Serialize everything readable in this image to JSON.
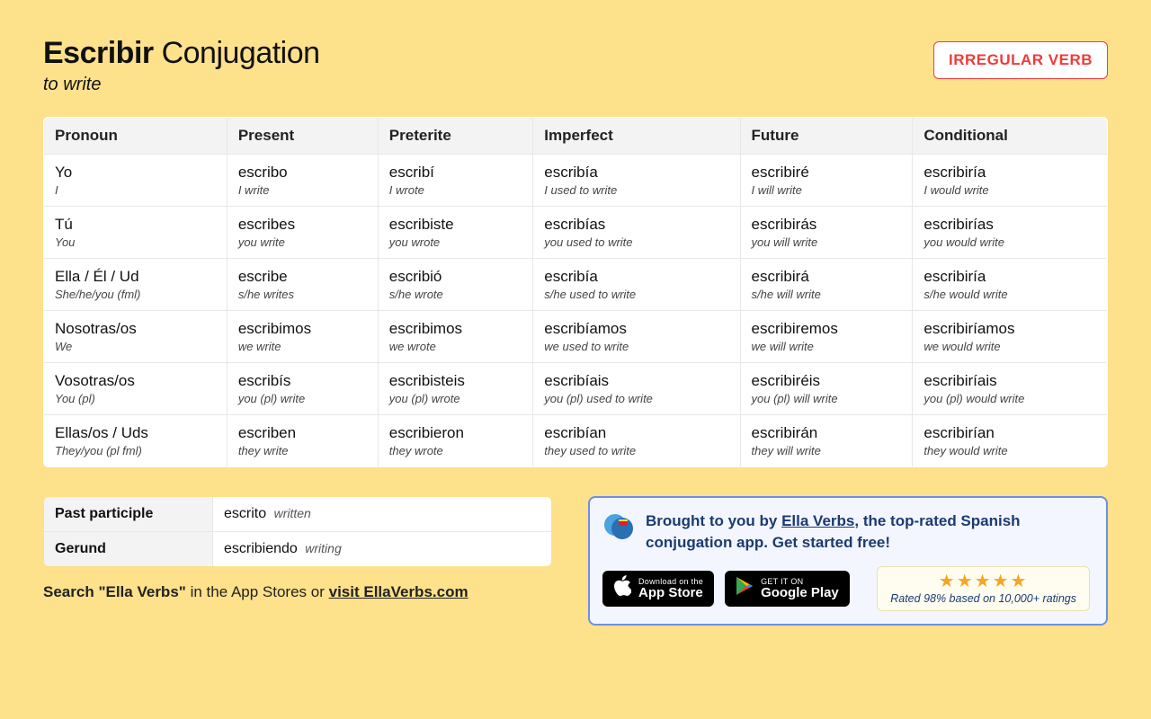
{
  "header": {
    "verb": "Escribir",
    "word_conjugation": "Conjugation",
    "translation": "to write",
    "badge": "IRREGULAR VERB"
  },
  "table": {
    "columns": [
      "Pronoun",
      "Present",
      "Preterite",
      "Imperfect",
      "Future",
      "Conditional"
    ],
    "rows": [
      {
        "pronoun": {
          "es": "Yo",
          "en": "I"
        },
        "cells": [
          {
            "es": "escribo",
            "en": "I write"
          },
          {
            "es": "escribí",
            "en": "I wrote"
          },
          {
            "es": "escribía",
            "en": "I used to write"
          },
          {
            "es": "escribiré",
            "en": "I will write"
          },
          {
            "es": "escribiría",
            "en": "I would write"
          }
        ]
      },
      {
        "pronoun": {
          "es": "Tú",
          "en": "You"
        },
        "cells": [
          {
            "es": "escribes",
            "en": "you write"
          },
          {
            "es": "escribiste",
            "en": "you wrote"
          },
          {
            "es": "escribías",
            "en": "you used to write"
          },
          {
            "es": "escribirás",
            "en": "you will write"
          },
          {
            "es": "escribirías",
            "en": "you would write"
          }
        ]
      },
      {
        "pronoun": {
          "es": "Ella / Él / Ud",
          "en": "She/he/you (fml)"
        },
        "cells": [
          {
            "es": "escribe",
            "en": "s/he writes"
          },
          {
            "es": "escribió",
            "en": "s/he wrote"
          },
          {
            "es": "escribía",
            "en": "s/he used to write"
          },
          {
            "es": "escribirá",
            "en": "s/he will write"
          },
          {
            "es": "escribiría",
            "en": "s/he would write"
          }
        ]
      },
      {
        "pronoun": {
          "es": "Nosotras/os",
          "en": "We"
        },
        "cells": [
          {
            "es": "escribimos",
            "en": "we write"
          },
          {
            "es": "escribimos",
            "en": "we wrote"
          },
          {
            "es": "escribíamos",
            "en": "we used to write"
          },
          {
            "es": "escribiremos",
            "en": "we will write"
          },
          {
            "es": "escribiríamos",
            "en": "we would write"
          }
        ]
      },
      {
        "pronoun": {
          "es": "Vosotras/os",
          "en": "You (pl)"
        },
        "cells": [
          {
            "es": "escribís",
            "en": "you (pl) write"
          },
          {
            "es": "escribisteis",
            "en": "you (pl) wrote"
          },
          {
            "es": "escribíais",
            "en": "you (pl) used to write"
          },
          {
            "es": "escribiréis",
            "en": "you (pl) will write"
          },
          {
            "es": "escribiríais",
            "en": "you (pl) would write"
          }
        ]
      },
      {
        "pronoun": {
          "es": "Ellas/os / Uds",
          "en": "They/you (pl fml)"
        },
        "cells": [
          {
            "es": "escriben",
            "en": "they write"
          },
          {
            "es": "escribieron",
            "en": "they wrote"
          },
          {
            "es": "escribían",
            "en": "they used to write"
          },
          {
            "es": "escribirán",
            "en": "they will write"
          },
          {
            "es": "escribirían",
            "en": "they would write"
          }
        ]
      }
    ]
  },
  "participles": [
    {
      "label": "Past participle",
      "es": "escrito",
      "en": "written"
    },
    {
      "label": "Gerund",
      "es": "escribiendo",
      "en": "writing"
    }
  ],
  "search_line": {
    "prefix": "Search ",
    "quoted": "\"Ella Verbs\"",
    "mid": " in the App Stores or ",
    "link": "visit EllaVerbs.com"
  },
  "promo": {
    "text_prefix": "Brought to you by ",
    "link": "Ella Verbs",
    "text_suffix": ", the top-rated Spanish conjugation app. Get started free!",
    "appstore": {
      "top": "Download on the",
      "bot": "App Store"
    },
    "play": {
      "top": "GET IT ON",
      "bot": "Google Play"
    },
    "rating_text": "Rated 98% based on 10,000+ ratings"
  }
}
